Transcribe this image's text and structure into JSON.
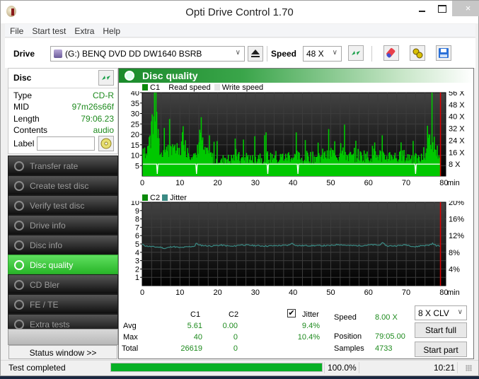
{
  "window": {
    "title": "Opti Drive Control 1.70",
    "close_glyph": "×"
  },
  "menu": [
    "File",
    "Start test",
    "Extra",
    "Help"
  ],
  "drivebar": {
    "drive_label": "Drive",
    "drive_value": "(G:)  BENQ DVD DD DW1640 BSRB",
    "speed_label": "Speed",
    "speed_value": "48 X"
  },
  "disc": {
    "header": "Disc",
    "fields": [
      {
        "key": "Type",
        "value": "CD-R"
      },
      {
        "key": "MID",
        "value": "97m26s66f"
      },
      {
        "key": "Length",
        "value": "79:06.23"
      },
      {
        "key": "Contents",
        "value": "audio"
      }
    ],
    "label_key": "Label",
    "label_value": ""
  },
  "nav": [
    {
      "label": "Transfer rate",
      "active": false
    },
    {
      "label": "Create test disc",
      "active": false
    },
    {
      "label": "Verify test disc",
      "active": false
    },
    {
      "label": "Drive info",
      "active": false
    },
    {
      "label": "Disc info",
      "active": false
    },
    {
      "label": "Disc quality",
      "active": true
    },
    {
      "label": "CD Bler",
      "active": false
    },
    {
      "label": "FE / TE",
      "active": false
    },
    {
      "label": "Extra tests",
      "active": false
    }
  ],
  "status_window_button": "Status window >>",
  "panel_title": "Disc quality",
  "colors": {
    "c1": "#00c800",
    "c2": "#0a8a0a",
    "jitter": "#3a8a84",
    "read_speed": "#ffffff",
    "write_speed": "#e8e8e8",
    "marker": "#e00000",
    "accent": "#2ab52a"
  },
  "chart_data": [
    {
      "type": "bar",
      "title": "C1",
      "legend": [
        "C1",
        "Read speed",
        "Write speed"
      ],
      "xlabel": "min",
      "x_ticks": [
        "0",
        "10",
        "20",
        "30",
        "40",
        "50",
        "60",
        "70",
        "80"
      ],
      "xlim": [
        0,
        80
      ],
      "y_ticks_left": [
        "5",
        "10",
        "15",
        "20",
        "25",
        "30",
        "35",
        "40"
      ],
      "ylim": [
        0,
        40
      ],
      "y_ticks_right": [
        "8 X",
        "16 X",
        "24 X",
        "32 X",
        "40 X",
        "48 X",
        "56 X"
      ],
      "y2lim": [
        0,
        56
      ],
      "end_marker_min": 79.1,
      "read_speed_x": 8,
      "read_speed_dips_min": [
        4.0,
        14.4,
        33.3,
        41.3,
        72.5
      ],
      "c1_profile": [
        [
          0,
          14
        ],
        [
          0.5,
          18
        ],
        [
          1,
          12
        ],
        [
          1.5,
          16
        ],
        [
          2,
          22
        ],
        [
          2.5,
          18
        ],
        [
          3,
          30
        ],
        [
          3.5,
          40
        ],
        [
          4,
          24
        ],
        [
          4.5,
          15
        ],
        [
          5,
          12
        ],
        [
          5.5,
          16
        ],
        [
          6,
          14
        ],
        [
          6.5,
          18
        ],
        [
          7,
          13
        ],
        [
          7.5,
          14
        ],
        [
          8,
          20
        ],
        [
          8.5,
          13
        ],
        [
          9,
          15
        ],
        [
          9.5,
          12
        ],
        [
          10,
          14
        ],
        [
          10.5,
          18
        ],
        [
          11,
          26
        ],
        [
          11.5,
          14
        ],
        [
          12,
          16
        ],
        [
          12.5,
          12
        ],
        [
          13,
          15
        ],
        [
          13.5,
          11
        ],
        [
          14,
          10
        ],
        [
          14.5,
          12
        ],
        [
          15,
          22
        ],
        [
          15.5,
          28
        ],
        [
          16,
          17
        ],
        [
          16.5,
          12
        ],
        [
          17,
          14
        ],
        [
          17.5,
          10
        ],
        [
          18,
          12
        ],
        [
          19,
          9
        ],
        [
          20,
          10
        ],
        [
          21,
          8
        ],
        [
          22,
          11
        ],
        [
          23,
          9
        ],
        [
          24,
          10
        ],
        [
          25,
          12
        ],
        [
          26,
          9
        ],
        [
          27,
          10
        ],
        [
          28,
          11
        ],
        [
          29,
          9
        ],
        [
          30,
          10
        ],
        [
          31,
          12
        ],
        [
          32,
          9
        ],
        [
          33,
          11
        ],
        [
          34,
          10
        ],
        [
          35,
          12
        ],
        [
          36,
          9
        ],
        [
          37,
          11
        ],
        [
          38,
          10
        ],
        [
          39,
          12
        ],
        [
          40,
          10
        ],
        [
          41,
          11
        ],
        [
          42,
          10
        ],
        [
          43,
          9
        ],
        [
          44,
          12
        ],
        [
          45,
          10
        ],
        [
          46,
          11
        ],
        [
          47,
          10
        ],
        [
          48,
          12
        ],
        [
          49,
          11
        ],
        [
          50,
          13
        ],
        [
          51,
          12
        ],
        [
          52,
          11
        ],
        [
          53,
          20
        ],
        [
          54,
          12
        ],
        [
          55,
          11
        ],
        [
          56,
          10
        ],
        [
          57,
          12
        ],
        [
          58,
          11
        ],
        [
          59,
          12
        ],
        [
          60,
          10
        ],
        [
          61,
          13
        ],
        [
          62,
          11
        ],
        [
          63,
          12
        ],
        [
          64,
          10
        ],
        [
          65,
          11
        ],
        [
          66,
          12
        ],
        [
          67,
          11
        ],
        [
          68,
          10
        ],
        [
          69,
          12
        ],
        [
          70,
          10
        ],
        [
          71,
          11
        ],
        [
          72,
          10
        ],
        [
          73,
          9
        ],
        [
          74,
          10
        ],
        [
          75,
          11
        ],
        [
          76,
          22
        ],
        [
          77,
          20
        ],
        [
          78,
          14
        ],
        [
          79,
          12
        ]
      ],
      "c1_stats": {
        "avg": "5.61",
        "max": "40",
        "total": "26619"
      }
    },
    {
      "type": "line",
      "title": "C2 / Jitter",
      "legend": [
        "C2",
        "Jitter"
      ],
      "xlabel": "min",
      "x_ticks": [
        "0",
        "10",
        "20",
        "30",
        "40",
        "50",
        "60",
        "70",
        "80"
      ],
      "xlim": [
        0,
        80
      ],
      "y_ticks_left": [
        "1",
        "2",
        "3",
        "4",
        "5",
        "6",
        "7",
        "8",
        "9",
        "10"
      ],
      "ylim": [
        0,
        10
      ],
      "y_ticks_right": [
        "4%",
        "8%",
        "12%",
        "16%",
        "20%"
      ],
      "y2lim": [
        0,
        20
      ],
      "end_marker_min": 79.1,
      "c2_values": [],
      "jitter_profile_pct": [
        [
          0,
          9.9
        ],
        [
          1,
          9.5
        ],
        [
          3,
          9.3
        ],
        [
          5,
          9.2
        ],
        [
          6,
          8.9
        ],
        [
          8,
          9.4
        ],
        [
          10,
          9.1
        ],
        [
          12,
          9.3
        ],
        [
          14,
          9.5
        ],
        [
          14.4,
          10.3
        ],
        [
          15,
          9.7
        ],
        [
          18,
          9.5
        ],
        [
          21,
          9.7
        ],
        [
          24,
          9.4
        ],
        [
          26,
          9.8
        ],
        [
          30,
          9.6
        ],
        [
          33,
          9.5
        ],
        [
          36,
          9.6
        ],
        [
          39,
          9.7
        ],
        [
          39.5,
          10.2
        ],
        [
          41,
          9.6
        ],
        [
          45,
          9.6
        ],
        [
          50,
          9.6
        ],
        [
          52,
          9.9
        ],
        [
          55,
          9.6
        ],
        [
          58,
          9.6
        ],
        [
          61,
          9.8
        ],
        [
          63,
          9.7
        ],
        [
          63.5,
          10.3
        ],
        [
          65,
          9.5
        ],
        [
          68,
          9.6
        ],
        [
          70,
          9.8
        ],
        [
          72.5,
          9.3
        ],
        [
          74,
          9.6
        ],
        [
          76,
          9.7
        ],
        [
          77,
          10.1
        ],
        [
          78,
          9.6
        ],
        [
          79,
          9.5
        ]
      ],
      "c2_stats": {
        "avg": "0.00",
        "max": "0",
        "total": "0"
      },
      "jitter_stats": {
        "avg": "9.4%",
        "max": "10.4%"
      }
    }
  ],
  "stats": {
    "col_c1": "C1",
    "col_c2": "C2",
    "jitter_label": "Jitter",
    "jitter_checked": true,
    "rows": [
      {
        "label": "Avg",
        "c1": "5.61",
        "c2": "0.00",
        "jitter": "9.4%"
      },
      {
        "label": "Max",
        "c1": "40",
        "c2": "0",
        "jitter": "10.4%"
      },
      {
        "label": "Total",
        "c1": "26619",
        "c2": "0",
        "jitter": ""
      }
    ]
  },
  "test_info": {
    "speed_label": "Speed",
    "speed_value": "8.00 X",
    "position_label": "Position",
    "position_value": "79:05.00",
    "samples_label": "Samples",
    "samples_value": "4733",
    "mode_value": "8 X CLV",
    "start_full": "Start full",
    "start_part": "Start part"
  },
  "statusbar": {
    "message": "Test completed",
    "progress_pct": 100.0,
    "progress_text": "100.0%",
    "time": "10:21"
  }
}
